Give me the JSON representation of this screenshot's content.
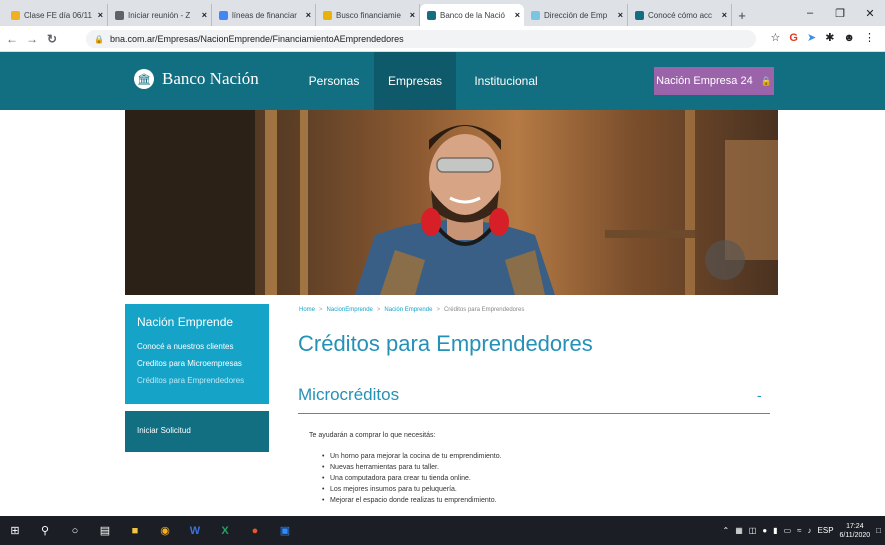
{
  "browser": {
    "tabs": [
      {
        "title": "Clase FE día 06/11",
        "icon_color": "#f2b01e"
      },
      {
        "title": "Iniciar reunión - Z",
        "icon_color": "#5f6368"
      },
      {
        "title": "líneas de financiar",
        "icon_color": "#4285f4"
      },
      {
        "title": "Busco financiamie",
        "icon_color": "#e8b20b"
      },
      {
        "title": "Banco de la Nació",
        "icon_color": "#126f82"
      },
      {
        "title": "Dirección de Emp",
        "icon_color": "#7cc4e4"
      },
      {
        "title": "Conocé cómo acc",
        "icon_color": "#126f82"
      }
    ],
    "active_tab": 4,
    "url": "bna.com.ar/Empresas/NacionEmprende/FinanciamientoAEmprendedores"
  },
  "site": {
    "logo": "Banco Nación",
    "nav": [
      "Personas",
      "Empresas",
      "Institucional"
    ],
    "nav_active": "Empresas",
    "cta": "Nación Empresa 24",
    "brand_color": "#126f82",
    "accent_color": "#15a3c8",
    "cta_color": "#9b63a9"
  },
  "sidebar": {
    "title": "Nación Emprende",
    "items": [
      "Conocé a nuestros clientes",
      "Creditos para Microempresas",
      "Créditos para Emprendedores"
    ],
    "current_item": 2,
    "action": "Iniciar Solicitud"
  },
  "breadcrumb": [
    "Home",
    "NacionEmprende",
    "Nación Emprende",
    "Créditos para Emprendedores"
  ],
  "main": {
    "title": "Créditos para Emprendedores",
    "section_title": "Microcréditos",
    "collapse_symbol": "-",
    "intro": "Te ayudarán a comprar lo que necesitás:",
    "bullets": [
      "Un horno para mejorar la cocina de tu emprendimiento.",
      "Nuevas herramientas para tu taller.",
      "Una computadora para crear tu tienda online.",
      "Los mejores insumos para tu peluquería.",
      "Mejorar el espacio donde realizas tu emprendimiento."
    ]
  },
  "taskbar": {
    "lang": "ESP",
    "time": "17:24",
    "date": "6/11/2020"
  }
}
